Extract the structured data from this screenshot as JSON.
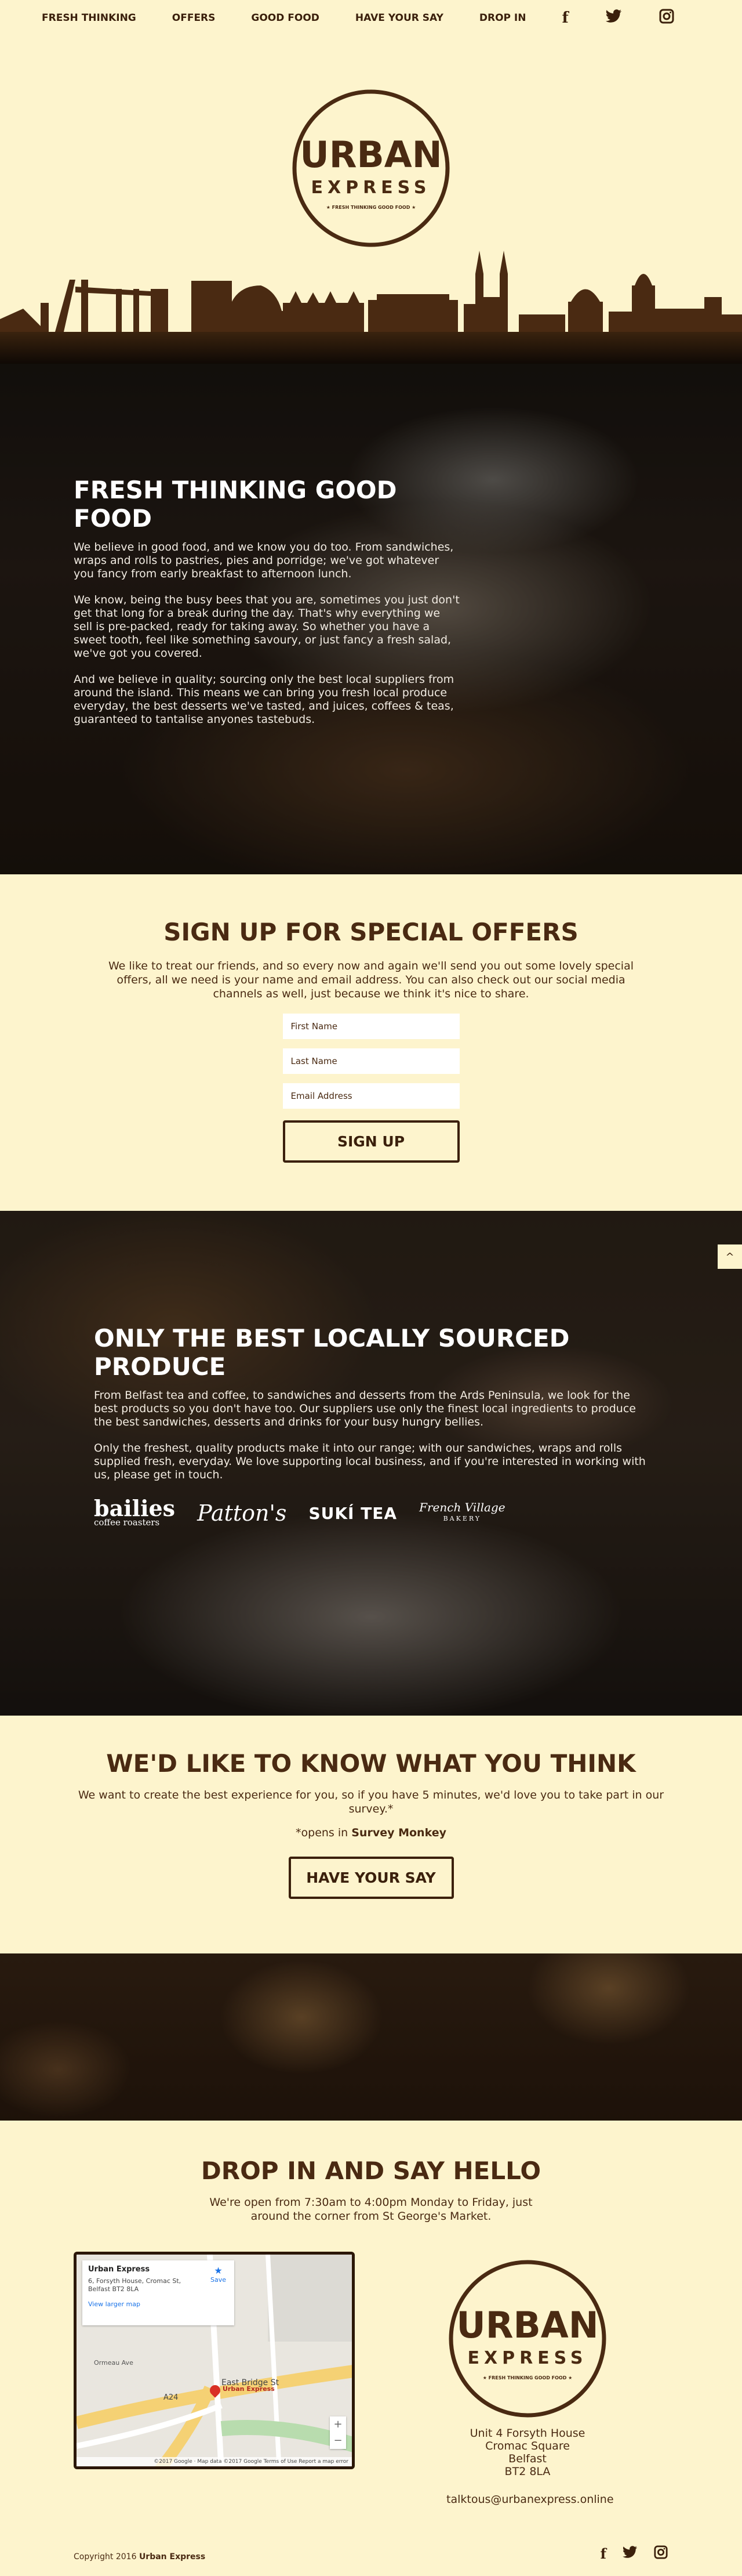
{
  "nav": {
    "items": [
      "FRESH THINKING",
      "OFFERS",
      "GOOD FOOD",
      "HAVE YOUR SAY",
      "DROP IN"
    ],
    "social": {
      "facebook": "f",
      "twitter": "❧",
      "instagram": "▣"
    }
  },
  "logo": {
    "line1": "URBAN",
    "line2": "EXPRESS",
    "tagline": "★ FRESH THINKING GOOD FOOD ★"
  },
  "hero": {
    "title": "FRESH THINKING GOOD FOOD",
    "p1": "We believe in good food, and we know you do too. From sandwiches, wraps and rolls to pastries, pies and porridge; we've got whatever you fancy from early breakfast to afternoon lunch.",
    "p2": "We know, being the busy bees that you are, sometimes you just don't get that long for a break during the day. That's why everything we sell is pre-packed, ready for taking away. So whether you have a sweet tooth, feel like something savoury, or just fancy a fresh salad, we've got you covered.",
    "p3": "And we believe in quality; sourcing only the best local suppliers from around the island. This means we can bring you fresh local produce everyday, the best desserts we've tasted, and juices, coffees & teas, guaranteed to tantalise anyones tastebuds."
  },
  "signup": {
    "title": "SIGN UP FOR SPECIAL OFFERS",
    "lead": "We like to treat our friends, and so every now and again we'll send you out some lovely special offers, all we need is your name and email address. You can also check out our social media channels as well, just because we think it's nice to share.",
    "first_name_placeholder": "First Name",
    "last_name_placeholder": "Last Name",
    "email_placeholder": "Email Address",
    "button": "SIGN UP"
  },
  "produce": {
    "title": "ONLY THE BEST LOCALLY SOURCED PRODUCE",
    "p1": "From Belfast tea and coffee, to sandwiches and desserts from the Ards Peninsula, we look for the best products so you don't have too. Our suppliers use only the finest local ingredients to produce the best sandwiches, desserts and drinks for your busy hungry bellies.",
    "p2": "Only the freshest, quality products make it into our range; with our sandwiches, wraps and rolls supplied fresh, everyday. We love supporting local business, and if you're interested in working with us, please get in touch.",
    "brands": {
      "bailies": "bailies",
      "bailies_sub": "coffee roasters",
      "pattons": "Patton's",
      "suki": "SUKÍ TEA",
      "village": "French Village",
      "village_sub": "BAKERY"
    },
    "scroll_top": "^"
  },
  "survey": {
    "title": "WE'D LIKE TO KNOW WHAT YOU THINK",
    "lead": "We want to create the best experience for you, so if you have 5 minutes, we'd love you to take part in our survey.*",
    "note_prefix": "*opens in ",
    "note_brand": "Survey Monkey",
    "button": "HAVE YOUR SAY"
  },
  "dropin": {
    "title": "DROP IN AND SAY HELLO",
    "lead": "We're open from 7:30am to 4:00pm Monday to Friday, just around the corner from St George's Market.",
    "map": {
      "place": "Urban Express",
      "address": "6, Forsyth House, Cromac St, Belfast BT2 8LA",
      "larger": "View larger map",
      "save": "Save",
      "pin": "Urban Express",
      "footer": "©2017 Google · Map data ©2017 Google   Terms of Use   Report a map error",
      "streets": [
        "East Bridge St",
        "A24",
        "Ormeau Ave"
      ]
    },
    "address": [
      "Unit 4 Forsyth House",
      "Cromac Square",
      "Belfast",
      "BT2 8LA"
    ],
    "email": "talktous@urbanexpress.online"
  },
  "footer": {
    "copy": "Copyright 2016 ",
    "brand": "Urban Express"
  },
  "colors": {
    "background": "#fdf4cd",
    "brand_brown": "#4a2a12",
    "dark_brown": "#3b200c"
  }
}
